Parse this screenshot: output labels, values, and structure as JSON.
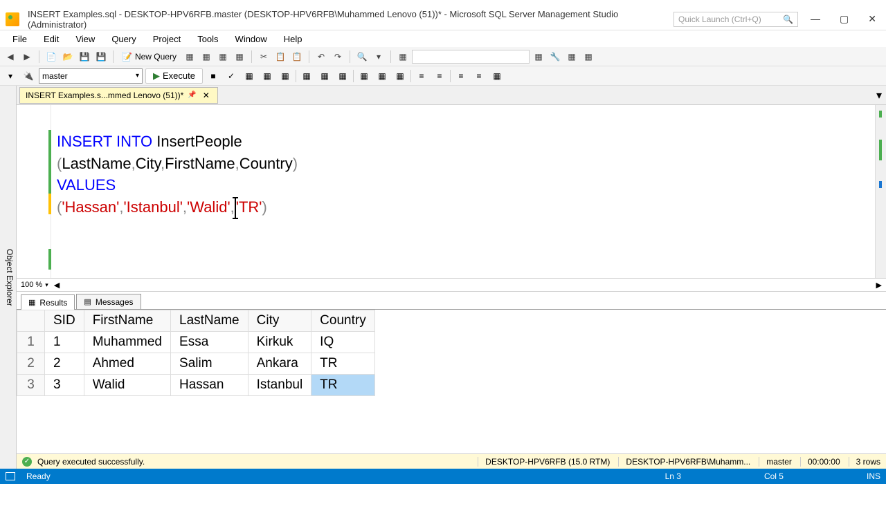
{
  "title_bar": {
    "title": "INSERT Examples.sql - DESKTOP-HPV6RFB.master (DESKTOP-HPV6RFB\\Muhammed Lenovo (51))* - Microsoft SQL Server Management Studio (Administrator)",
    "search_placeholder": "Quick Launch (Ctrl+Q)"
  },
  "menu": {
    "items": [
      "File",
      "Edit",
      "View",
      "Query",
      "Project",
      "Tools",
      "Window",
      "Help"
    ]
  },
  "toolbar": {
    "new_query": "New Query",
    "database": "master",
    "execute": "Execute"
  },
  "tab": {
    "label": "INSERT Examples.s...mmed Lenovo (51))*"
  },
  "code": {
    "line1_kw": "INSERT INTO",
    "line1_id": " InsertPeople",
    "line2": "(LastName,City,FirstName,Country)",
    "line3_kw": "VALUES",
    "line4_open": "(",
    "line4_s1": "'Hassan'",
    "line4_c1": ",",
    "line4_s2": "'Istanbul'",
    "line4_c2": ",",
    "line4_s3": "'Walid'",
    "line4_c3": ",",
    "line4_s4": "'TR'",
    "line4_close": ")"
  },
  "zoom": "100 %",
  "result_tabs": {
    "results": "Results",
    "messages": "Messages"
  },
  "grid": {
    "columns": [
      "",
      "SID",
      "FirstName",
      "LastName",
      "City",
      "Country"
    ],
    "rows": [
      {
        "n": "1",
        "sid": "1",
        "fn": "Muhammed",
        "ln": "Essa",
        "city": "Kirkuk",
        "country": "IQ"
      },
      {
        "n": "2",
        "sid": "2",
        "fn": "Ahmed",
        "ln": "Salim",
        "city": "Ankara",
        "country": "TR"
      },
      {
        "n": "3",
        "sid": "3",
        "fn": "Walid",
        "ln": "Hassan",
        "city": "Istanbul",
        "country": "TR"
      }
    ]
  },
  "status1": {
    "message": "Query executed successfully.",
    "server": "DESKTOP-HPV6RFB (15.0 RTM)",
    "user": "DESKTOP-HPV6RFB\\Muhamm...",
    "db": "master",
    "time": "00:00:00",
    "rows": "3 rows"
  },
  "status2": {
    "ready": "Ready",
    "ln": "Ln 3",
    "col": "Col 5",
    "ins": "INS"
  },
  "obj_explorer_label": "Object Explorer",
  "chart_data": {
    "type": "table",
    "title": "Query Results",
    "columns": [
      "SID",
      "FirstName",
      "LastName",
      "City",
      "Country"
    ],
    "rows": [
      [
        1,
        "Muhammed",
        "Essa",
        "Kirkuk",
        "IQ"
      ],
      [
        2,
        "Ahmed",
        "Salim",
        "Ankara",
        "TR"
      ],
      [
        3,
        "Walid",
        "Hassan",
        "Istanbul",
        "TR"
      ]
    ]
  }
}
